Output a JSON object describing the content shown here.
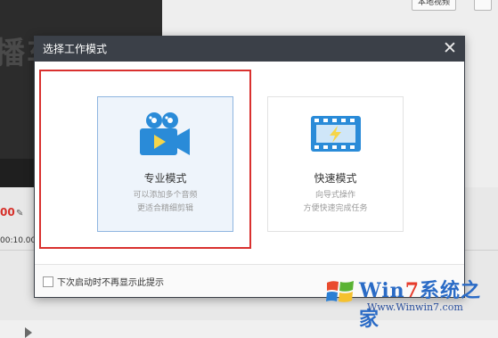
{
  "background": {
    "preview_text": "播车",
    "duration_text": "00",
    "timecode": "00:10.00",
    "top_button_local": "本地视频",
    "top_button_other": ""
  },
  "dialog": {
    "title": "选择工作模式",
    "close_glyph": "✕",
    "modes": [
      {
        "title": "专业模式",
        "desc1": "可以添加多个音频",
        "desc2": "更适合精细剪辑",
        "icon": "video-camera-icon",
        "selected": true
      },
      {
        "title": "快速模式",
        "desc1": "向导式操作",
        "desc2": "方便快速完成任务",
        "icon": "film-strip-lightning-icon",
        "selected": false
      }
    ],
    "footer": {
      "checkbox_label": "下次启动时不再显示此提示",
      "checked": false
    }
  },
  "watermark": {
    "brand_prefix": "Win",
    "brand_seven": "7",
    "brand_suffix": "系统之家",
    "url": "Www.Winwin7.com"
  },
  "colors": {
    "header_bg": "#3b4048",
    "highlight_red": "#d9312f",
    "accent_blue": "#2a8bd8"
  }
}
